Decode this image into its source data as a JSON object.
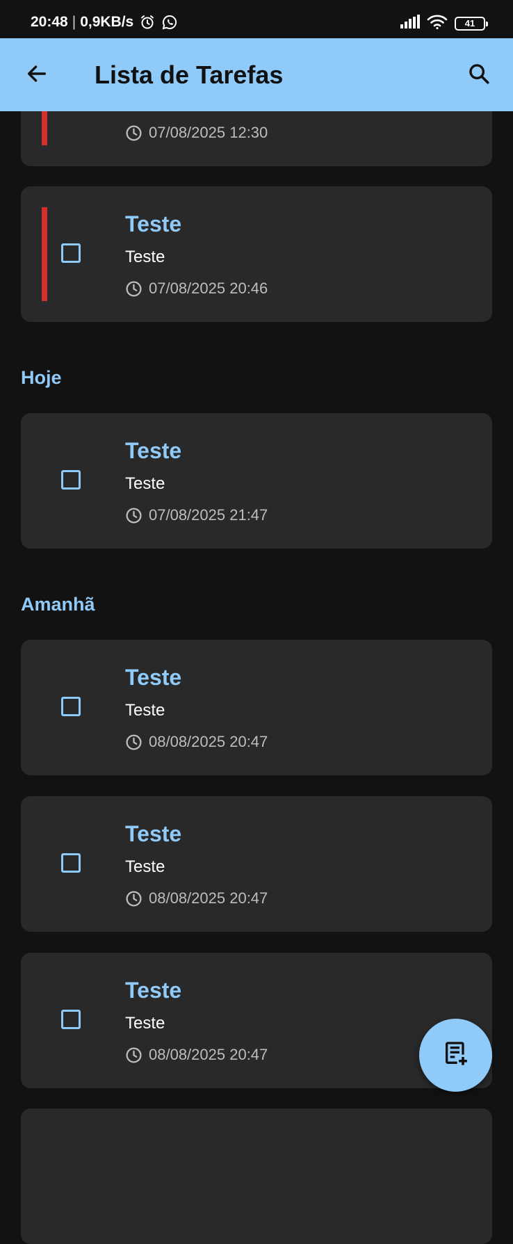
{
  "status_bar": {
    "time": "20:48",
    "net_speed": "0,9KB/s",
    "battery": "41",
    "icons": [
      "alarm-icon",
      "whatsapp-icon",
      "signal-icon",
      "wifi-icon",
      "battery-icon"
    ]
  },
  "app_bar": {
    "title": "Lista de Tarefas",
    "back_icon": "arrow-back-icon",
    "search_icon": "search-icon",
    "background": "#90caf9"
  },
  "overdue_tasks": [
    {
      "title": "",
      "description": "",
      "time": "07/08/2025 12:30",
      "overdue": true
    },
    {
      "title": "Teste",
      "description": "Teste",
      "time": "07/08/2025 20:46",
      "overdue": true
    }
  ],
  "sections": {
    "today": {
      "label": "Hoje",
      "tasks": [
        {
          "title": "Teste",
          "description": "Teste",
          "time": "07/08/2025 21:47"
        }
      ]
    },
    "tomorrow": {
      "label": "Amanhã",
      "tasks": [
        {
          "title": "Teste",
          "description": "Teste",
          "time": "08/08/2025 20:47"
        },
        {
          "title": "Teste",
          "description": "Teste",
          "time": "08/08/2025 20:47"
        },
        {
          "title": "Teste",
          "description": "Teste",
          "time": "08/08/2025 20:47"
        }
      ]
    }
  },
  "fab": {
    "icon": "add-task-icon"
  },
  "colors": {
    "accent": "#90caf9",
    "overdue": "#d32f2f",
    "card": "#292929",
    "background": "#121212"
  }
}
